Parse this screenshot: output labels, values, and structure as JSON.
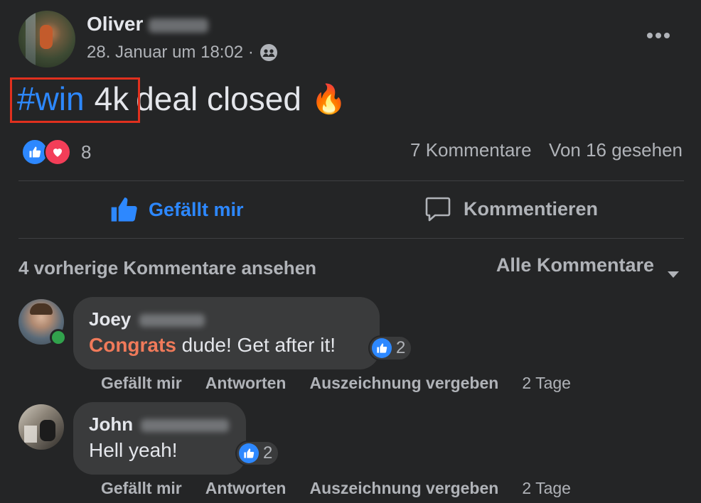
{
  "post": {
    "author_first_name": "Oliver",
    "timestamp": "28. Januar um 18:02 ·",
    "hashtag": "#win",
    "text_highlight": "4k",
    "text_rest": "deal closed",
    "emoji": "🔥",
    "reactions_count": "8",
    "comments_count": "7 Kommentare",
    "seen_by": "Von 16 gesehen",
    "more_icon": "more-horizontal-icon",
    "audience_icon": "friends-icon"
  },
  "actions": {
    "like_label": "Gefällt mir",
    "comment_label": "Kommentieren"
  },
  "comments_header": {
    "previous": "4 vorherige Kommentare ansehen",
    "filter": "Alle Kommentare"
  },
  "comments": [
    {
      "first_name": "Joey",
      "highlight": "Congrats",
      "text": " dude! Get after it!",
      "likes": "2",
      "like_label": "Gefällt mir",
      "reply_label": "Antworten",
      "award_label": "Auszeichnung vergeben",
      "age": "2 Tage"
    },
    {
      "first_name": "John",
      "text": "Hell yeah!",
      "likes": "2",
      "like_label": "Gefällt mir",
      "reply_label": "Antworten",
      "award_label": "Auszeichnung vergeben",
      "age": "2 Tage"
    }
  ],
  "colors": {
    "background": "#242526",
    "accent_blue": "#2d88ff",
    "highlight_red": "#e0301e",
    "congrats_orange": "#f07a5a",
    "bubble": "#3a3b3c"
  }
}
